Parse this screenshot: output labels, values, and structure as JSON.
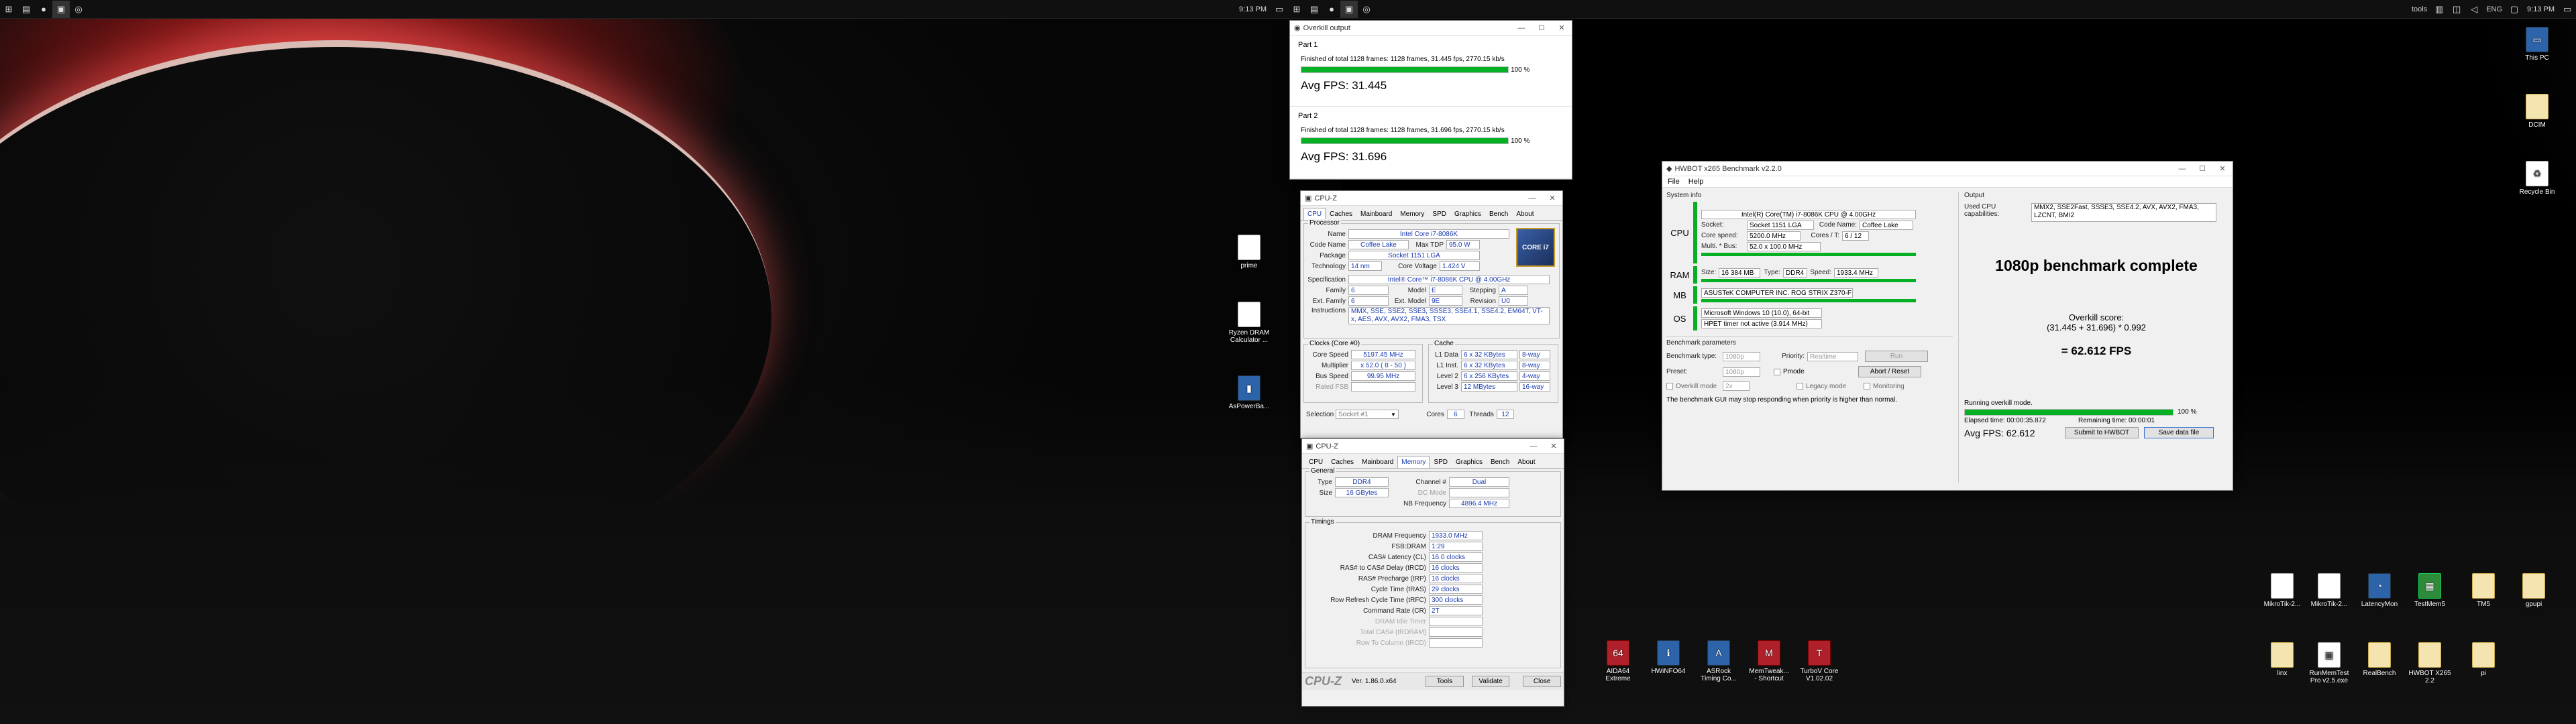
{
  "taskbar_left": {
    "time": "9:13 PM"
  },
  "taskbar_right": {
    "time": "9:13 PM",
    "lang": "ENG",
    "tools": "tools"
  },
  "desktop_icons_left": [
    {
      "label": "prime"
    },
    {
      "label": "Ryzen DRAM Calculator ..."
    },
    {
      "label": "AsPowerBa..."
    }
  ],
  "desktop_icons_right_top": [
    {
      "label": "This PC"
    },
    {
      "label": "DCIM"
    },
    {
      "label": "Recycle Bin"
    }
  ],
  "desktop_icons_row1": [
    {
      "label": "MikroTik-2..."
    },
    {
      "label": "MikroTik-2..."
    },
    {
      "label": "LatencyMon"
    },
    {
      "label": "TestMem5"
    },
    {
      "label": "TM5"
    },
    {
      "label": "gpupi"
    }
  ],
  "desktop_icons_row2": [
    {
      "label": "linx"
    },
    {
      "label": "RunMemTest Pro v2.5.exe"
    },
    {
      "label": "RealBench"
    },
    {
      "label": "HWBOT X265 2.2"
    },
    {
      "label": "pi"
    }
  ],
  "desktop_icons_bottom": [
    {
      "label": "AIDA64 Extreme"
    },
    {
      "label": "HWiNFO64"
    },
    {
      "label": "ASRock Timing Co..."
    },
    {
      "label": "MemTweak... - Shortcut"
    },
    {
      "label": "TurboV Core V1.02.02"
    }
  ],
  "overkill": {
    "title": "Overkill output",
    "parts": [
      {
        "name": "Part 1",
        "line": "Finished of total 1128 frames: 1128 frames, 31.445 fps,  2770.15 kb/s",
        "progress": 1,
        "pct": "100 %",
        "avg": "Avg FPS: 31.445"
      },
      {
        "name": "Part 2",
        "line": "Finished of total 1128 frames: 1128 frames, 31.696 fps,  2770.15 kb/s",
        "progress": 1,
        "pct": "100 %",
        "avg": "Avg FPS: 31.696"
      }
    ]
  },
  "cpuz1": {
    "title": "CPU-Z",
    "tabs": [
      "CPU",
      "Caches",
      "Mainboard",
      "Memory",
      "SPD",
      "Graphics",
      "Bench",
      "About"
    ],
    "processor": {
      "legend": "Processor",
      "name_l": "Name",
      "name": "Intel Core i7-8086K",
      "codename_l": "Code Name",
      "codename": "Coffee Lake",
      "maxtdp_l": "Max TDP",
      "maxtdp": "95.0 W",
      "package_l": "Package",
      "package": "Socket 1151 LGA",
      "tech_l": "Technology",
      "tech": "14 nm",
      "cv_l": "Core Voltage",
      "cv": "1.424 V",
      "spec_l": "Specification",
      "spec": "Intel® Core™ i7-8086K CPU @ 4.00GHz",
      "family_l": "Family",
      "family": "6",
      "model_l": "Model",
      "model": "E",
      "stepping_l": "Stepping",
      "stepping": "A",
      "extfam_l": "Ext. Family",
      "extfam": "6",
      "extmod_l": "Ext. Model",
      "extmod": "9E",
      "rev_l": "Revision",
      "rev": "U0",
      "instr_l": "Instructions",
      "instr": "MMX, SSE, SSE2, SSE3, SSSE3, SSE4.1, SSE4.2, EM64T, VT-x, AES, AVX, AVX2, FMA3, TSX",
      "badge": "CORE i7"
    },
    "clocks": {
      "legend": "Clocks (Core #0)",
      "cs_l": "Core Speed",
      "cs": "5197.45 MHz",
      "mult_l": "Multiplier",
      "mult": "x 52.0 ( 8 - 50 )",
      "bus_l": "Bus Speed",
      "bus": "99.95 MHz",
      "fsb_l": "Rated FSB",
      "fsb": ""
    },
    "cache": {
      "legend": "Cache",
      "l1d_l": "L1 Data",
      "l1d": "6 x 32 KBytes",
      "l1d_w": "8-way",
      "l1i_l": "L1 Inst.",
      "l1i": "6 x 32 KBytes",
      "l1i_w": "8-way",
      "l2_l": "Level 2",
      "l2": "6 x 256 KBytes",
      "l2_w": "4-way",
      "l3_l": "Level 3",
      "l3": "12 MBytes",
      "l3_w": "16-way"
    },
    "sel_l": "Selection",
    "sel": "Socket #1",
    "cores_l": "Cores",
    "cores": "6",
    "threads_l": "Threads",
    "threads": "12"
  },
  "cpuz2": {
    "title": "CPU-Z",
    "tabs": [
      "CPU",
      "Caches",
      "Mainboard",
      "Memory",
      "SPD",
      "Graphics",
      "Bench",
      "About"
    ],
    "general": {
      "legend": "General",
      "type_l": "Type",
      "type": "DDR4",
      "ch_l": "Channel #",
      "ch": "Dual",
      "size_l": "Size",
      "size": "16 GBytes",
      "dc_l": "DC Mode",
      "dc": "",
      "nb_l": "NB Frequency",
      "nb": "4896.4 MHz"
    },
    "timings": {
      "legend": "Timings",
      "rows": [
        {
          "l": "DRAM Frequency",
          "v": "1933.0 MHz"
        },
        {
          "l": "FSB:DRAM",
          "v": "1:29"
        },
        {
          "l": "CAS# Latency (CL)",
          "v": "16.0 clocks"
        },
        {
          "l": "RAS# to CAS# Delay (tRCD)",
          "v": "16 clocks"
        },
        {
          "l": "RAS# Precharge (tRP)",
          "v": "16 clocks"
        },
        {
          "l": "Cycle Time (tRAS)",
          "v": "29 clocks"
        },
        {
          "l": "Row Refresh Cycle Time (tRFC)",
          "v": "300 clocks"
        },
        {
          "l": "Command Rate (CR)",
          "v": "2T"
        },
        {
          "l": "DRAM Idle Timer",
          "v": ""
        },
        {
          "l": "Total CAS# (tRDRAM)",
          "v": ""
        },
        {
          "l": "Row To Column (tRCD)",
          "v": ""
        }
      ]
    },
    "footer": {
      "logo": "CPU-Z",
      "ver": "Ver. 1.86.0.x64",
      "tools": "Tools",
      "validate": "Validate",
      "close": "Close"
    }
  },
  "hwbot": {
    "title": "HWBOT x265 Benchmark v2.2.0",
    "menu": [
      "File",
      "Help"
    ],
    "sysinfo": "System info",
    "output": "Output",
    "cpu_label": "CPU",
    "cpu_name": "Intel(R) Core(TM) i7-8086K CPU @ 4.00GHz",
    "socket_l": "Socket:",
    "socket": "Socket 1151 LGA",
    "codename_l": "Code Name:",
    "codename": "Coffee Lake",
    "corespeed_l": "Core speed:",
    "corespeed": "5200.0 MHz",
    "cores_l": "Cores / T:",
    "cores": "6 / 12",
    "mult_l": "Multi. * Bus:",
    "mult": "52.0 x 100.0 MHz",
    "ram_label": "RAM",
    "size_l": "Size:",
    "size": "16 384 MB",
    "type_l": "Type:",
    "type": "DDR4",
    "speed_l": "Speed:",
    "speed": "1933.4 MHz",
    "mb_label": "MB",
    "mb": "ASUSTeK COMPUTER INC. ROG STRIX Z370-F GAMING",
    "os_label": "OS",
    "os": "Microsoft Windows 10 (10.0), 64-bit",
    "hpet": "HPET timer not active (3.914 MHz)",
    "params": "Benchmark parameters",
    "btype_l": "Benchmark type:",
    "btype": "1080p",
    "prio_l": "Priority:",
    "prio": "Realtime",
    "run": "Run",
    "preset_l": "Preset:",
    "preset": "1080p",
    "pmode": "Pmode",
    "abort": "Abort / Reset",
    "overkill": "Overkill mode",
    "ok_val": "2x",
    "legacy": "Legacy mode",
    "monitoring": "Monitoring",
    "warning": "The benchmark GUI may stop responding when priority is higher than normal.",
    "caps_l": "Used CPU capabilities:",
    "caps": "MMX2, SSE2Fast, SSSE3, SSE4.2, AVX, AVX2, FMA3, LZCNT, BMI2",
    "complete": "1080p benchmark complete",
    "score_l": "Overkill score:",
    "formula": "(31.445 + 31.696) * 0.992",
    "result": "= 62.612 FPS",
    "running": "Running overkill mode.",
    "progress": 1,
    "pct": "100 %",
    "elapsed": "Elapsed time: 00:00:35.872",
    "remaining": "Remaining time: 00:00:01",
    "avg": "Avg FPS: 62.612",
    "submit": "Submit to HWBOT",
    "save": "Save data file"
  }
}
